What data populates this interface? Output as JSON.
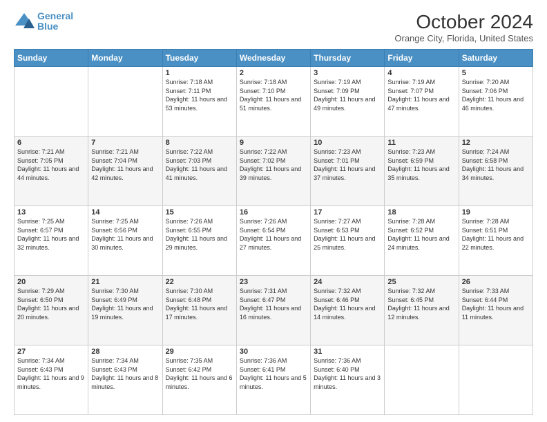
{
  "header": {
    "logo_line1": "General",
    "logo_line2": "Blue",
    "title": "October 2024",
    "subtitle": "Orange City, Florida, United States"
  },
  "weekdays": [
    "Sunday",
    "Monday",
    "Tuesday",
    "Wednesday",
    "Thursday",
    "Friday",
    "Saturday"
  ],
  "weeks": [
    [
      {
        "day": "",
        "info": ""
      },
      {
        "day": "",
        "info": ""
      },
      {
        "day": "1",
        "info": "Sunrise: 7:18 AM\nSunset: 7:11 PM\nDaylight: 11 hours and 53 minutes."
      },
      {
        "day": "2",
        "info": "Sunrise: 7:18 AM\nSunset: 7:10 PM\nDaylight: 11 hours and 51 minutes."
      },
      {
        "day": "3",
        "info": "Sunrise: 7:19 AM\nSunset: 7:09 PM\nDaylight: 11 hours and 49 minutes."
      },
      {
        "day": "4",
        "info": "Sunrise: 7:19 AM\nSunset: 7:07 PM\nDaylight: 11 hours and 47 minutes."
      },
      {
        "day": "5",
        "info": "Sunrise: 7:20 AM\nSunset: 7:06 PM\nDaylight: 11 hours and 46 minutes."
      }
    ],
    [
      {
        "day": "6",
        "info": "Sunrise: 7:21 AM\nSunset: 7:05 PM\nDaylight: 11 hours and 44 minutes."
      },
      {
        "day": "7",
        "info": "Sunrise: 7:21 AM\nSunset: 7:04 PM\nDaylight: 11 hours and 42 minutes."
      },
      {
        "day": "8",
        "info": "Sunrise: 7:22 AM\nSunset: 7:03 PM\nDaylight: 11 hours and 41 minutes."
      },
      {
        "day": "9",
        "info": "Sunrise: 7:22 AM\nSunset: 7:02 PM\nDaylight: 11 hours and 39 minutes."
      },
      {
        "day": "10",
        "info": "Sunrise: 7:23 AM\nSunset: 7:01 PM\nDaylight: 11 hours and 37 minutes."
      },
      {
        "day": "11",
        "info": "Sunrise: 7:23 AM\nSunset: 6:59 PM\nDaylight: 11 hours and 35 minutes."
      },
      {
        "day": "12",
        "info": "Sunrise: 7:24 AM\nSunset: 6:58 PM\nDaylight: 11 hours and 34 minutes."
      }
    ],
    [
      {
        "day": "13",
        "info": "Sunrise: 7:25 AM\nSunset: 6:57 PM\nDaylight: 11 hours and 32 minutes."
      },
      {
        "day": "14",
        "info": "Sunrise: 7:25 AM\nSunset: 6:56 PM\nDaylight: 11 hours and 30 minutes."
      },
      {
        "day": "15",
        "info": "Sunrise: 7:26 AM\nSunset: 6:55 PM\nDaylight: 11 hours and 29 minutes."
      },
      {
        "day": "16",
        "info": "Sunrise: 7:26 AM\nSunset: 6:54 PM\nDaylight: 11 hours and 27 minutes."
      },
      {
        "day": "17",
        "info": "Sunrise: 7:27 AM\nSunset: 6:53 PM\nDaylight: 11 hours and 25 minutes."
      },
      {
        "day": "18",
        "info": "Sunrise: 7:28 AM\nSunset: 6:52 PM\nDaylight: 11 hours and 24 minutes."
      },
      {
        "day": "19",
        "info": "Sunrise: 7:28 AM\nSunset: 6:51 PM\nDaylight: 11 hours and 22 minutes."
      }
    ],
    [
      {
        "day": "20",
        "info": "Sunrise: 7:29 AM\nSunset: 6:50 PM\nDaylight: 11 hours and 20 minutes."
      },
      {
        "day": "21",
        "info": "Sunrise: 7:30 AM\nSunset: 6:49 PM\nDaylight: 11 hours and 19 minutes."
      },
      {
        "day": "22",
        "info": "Sunrise: 7:30 AM\nSunset: 6:48 PM\nDaylight: 11 hours and 17 minutes."
      },
      {
        "day": "23",
        "info": "Sunrise: 7:31 AM\nSunset: 6:47 PM\nDaylight: 11 hours and 16 minutes."
      },
      {
        "day": "24",
        "info": "Sunrise: 7:32 AM\nSunset: 6:46 PM\nDaylight: 11 hours and 14 minutes."
      },
      {
        "day": "25",
        "info": "Sunrise: 7:32 AM\nSunset: 6:45 PM\nDaylight: 11 hours and 12 minutes."
      },
      {
        "day": "26",
        "info": "Sunrise: 7:33 AM\nSunset: 6:44 PM\nDaylight: 11 hours and 11 minutes."
      }
    ],
    [
      {
        "day": "27",
        "info": "Sunrise: 7:34 AM\nSunset: 6:43 PM\nDaylight: 11 hours and 9 minutes."
      },
      {
        "day": "28",
        "info": "Sunrise: 7:34 AM\nSunset: 6:43 PM\nDaylight: 11 hours and 8 minutes."
      },
      {
        "day": "29",
        "info": "Sunrise: 7:35 AM\nSunset: 6:42 PM\nDaylight: 11 hours and 6 minutes."
      },
      {
        "day": "30",
        "info": "Sunrise: 7:36 AM\nSunset: 6:41 PM\nDaylight: 11 hours and 5 minutes."
      },
      {
        "day": "31",
        "info": "Sunrise: 7:36 AM\nSunset: 6:40 PM\nDaylight: 11 hours and 3 minutes."
      },
      {
        "day": "",
        "info": ""
      },
      {
        "day": "",
        "info": ""
      }
    ]
  ]
}
